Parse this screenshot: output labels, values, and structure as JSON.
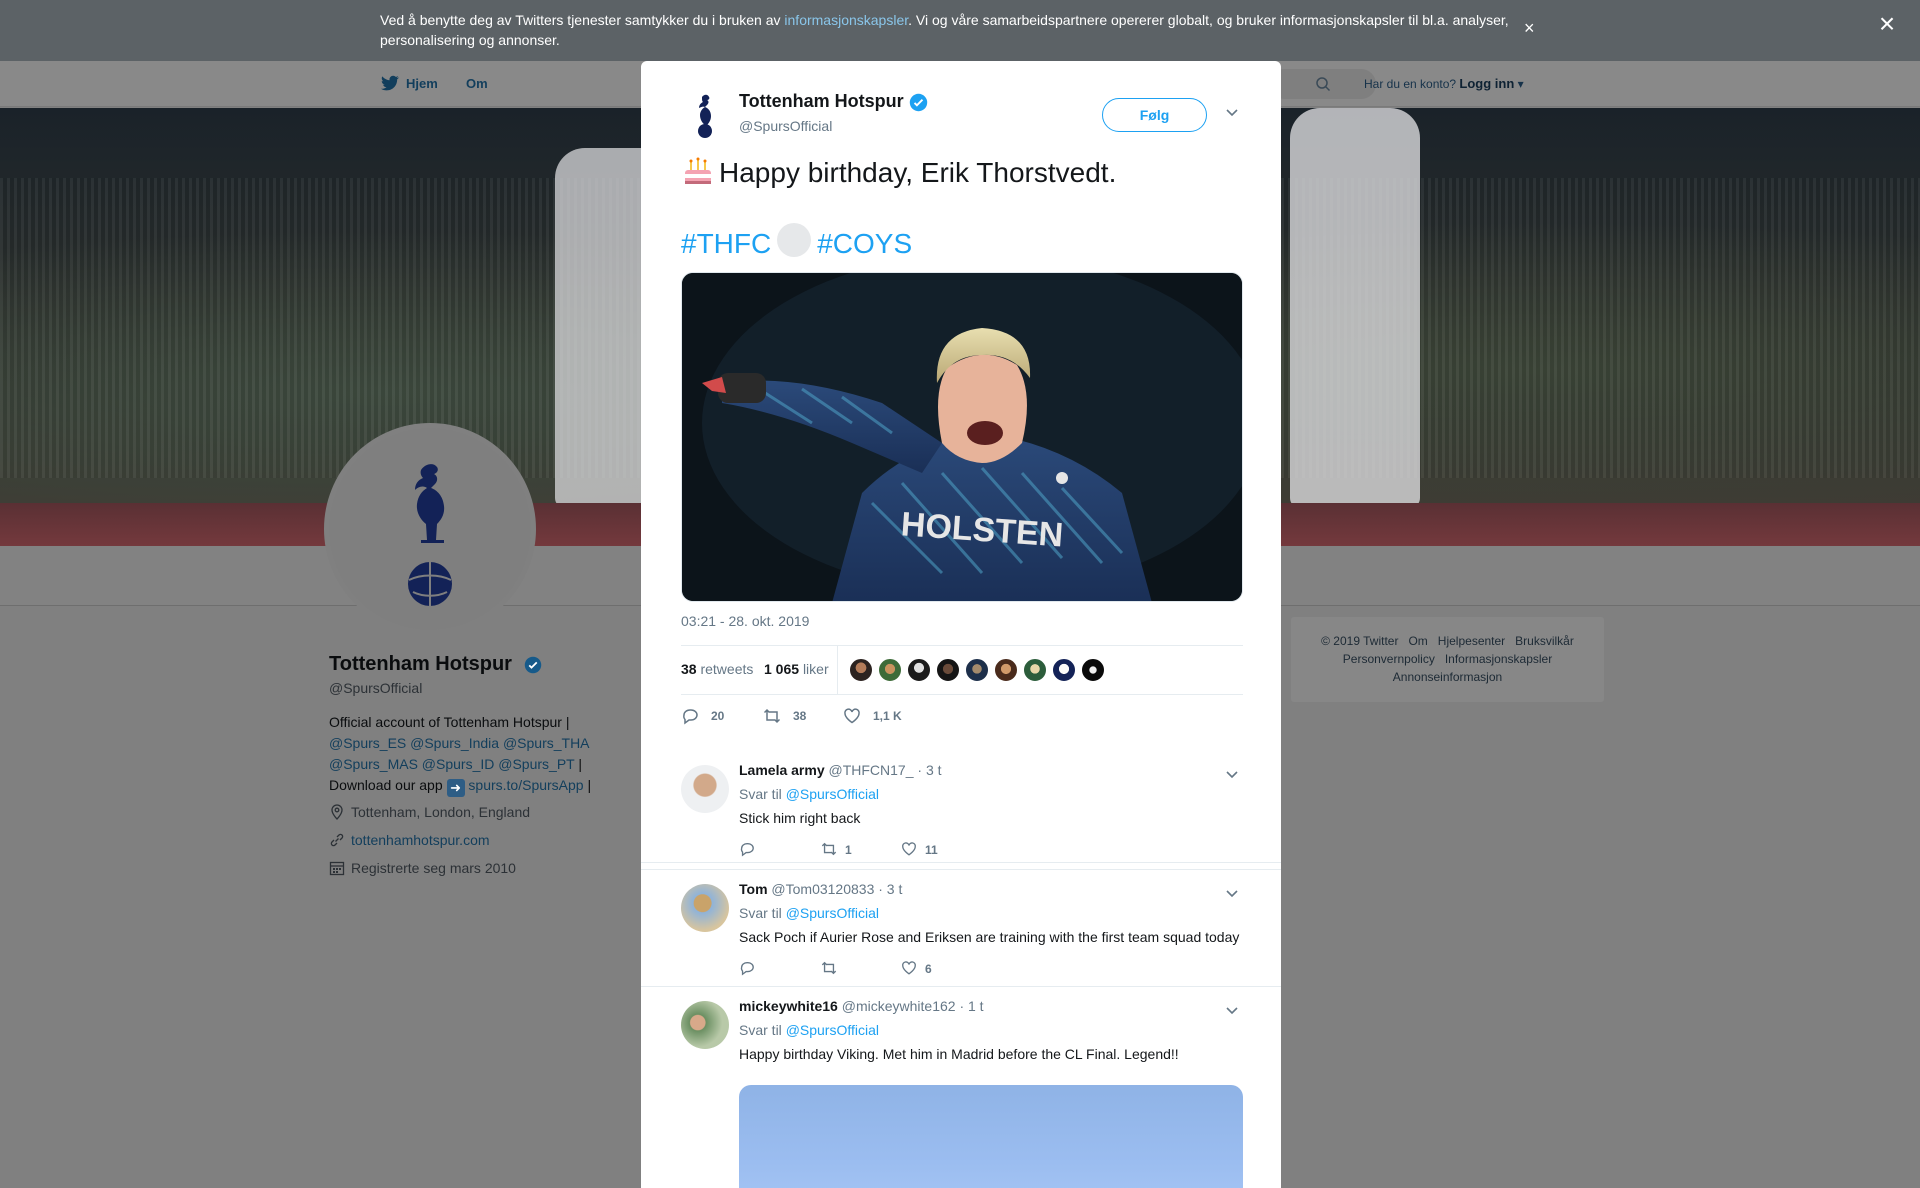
{
  "cookie_bar": {
    "text_before": "Ved å benytte deg av Twitters tjenester samtykker du i bruken av ",
    "link": "informasjonskapsler",
    "text_after": ". Vi og våre samarbeidspartnere opererer globalt, og bruker informasjonskapsler til bl.a. analyser, personalisering og annonser.",
    "close": "×"
  },
  "topnav": {
    "home": "Hjem",
    "about": "Om",
    "account_prompt": "Har du en konto?",
    "login": "Logg inn"
  },
  "profile": {
    "name": "Tottenham Hotspur",
    "handle": "@SpursOfficial",
    "bio_line1": "Official account of Tottenham Hotspur |",
    "bio_links1": "@Spurs_ES @Spurs_India @Spurs_THA",
    "bio_links2": "@Spurs_MAS @Spurs_ID @Spurs_PT",
    "bio_sep": " |",
    "bio_app_text": "Download our app ",
    "bio_app_link": "spurs.to/SpursApp",
    "bio_end": " |",
    "location": "Tottenham, London, England",
    "website": "tottenhamhotspur.com",
    "joined": "Registrerte seg mars 2010"
  },
  "footer": {
    "items": [
      "© 2019 Twitter",
      "Om",
      "Hjelpesenter",
      "Bruksvilkår",
      "Personvernpolicy",
      "Informasjonskapsler",
      "Annonseinformasjon"
    ]
  },
  "modal": {
    "close": "×",
    "author_name": "Tottenham Hotspur",
    "author_handle": "@SpursOfficial",
    "follow_label": "Følg",
    "text": "Happy birthday, Erik Thorstvedt.",
    "tag1": "#THFC",
    "tag2": "#COYS",
    "timestamp": "03:21 - 28. okt. 2019",
    "retweets_count": "38",
    "retweets_label": "retweets",
    "likes_count": "1 065",
    "likes_label": "liker",
    "actions": {
      "replies": "20",
      "retweets": "38",
      "likes": "1,1 K"
    },
    "photo_shirt_text": "HOLSTEN"
  },
  "replies": [
    {
      "name": "Lamela army",
      "handle": "@THFCN17_",
      "time": "· 3 t",
      "reply_to_label": "Svar til ",
      "reply_to": "@SpursOfficial",
      "text": "Stick him right back",
      "replies": "",
      "retweets": "1",
      "likes": "11"
    },
    {
      "name": "Tom",
      "handle": "@Tom03120833",
      "time": "· 3 t",
      "reply_to_label": "Svar til ",
      "reply_to": "@SpursOfficial",
      "text": "Sack Poch if Aurier Rose and Eriksen are training with the first team squad today",
      "replies": "",
      "retweets": "",
      "likes": "6"
    },
    {
      "name": "mickeywhite16",
      "handle": "@mickeywhite162",
      "time": "· 1 t",
      "reply_to_label": "Svar til ",
      "reply_to": "@SpursOfficial",
      "text": "Happy birthday Viking. Met him in Madrid before the CL Final. Legend!!",
      "replies": "",
      "retweets": "",
      "likes": ""
    }
  ],
  "colors": {
    "twitter_blue": "#1da1f2",
    "overlay_grey": "#808080",
    "spurs_navy": "#132257"
  }
}
